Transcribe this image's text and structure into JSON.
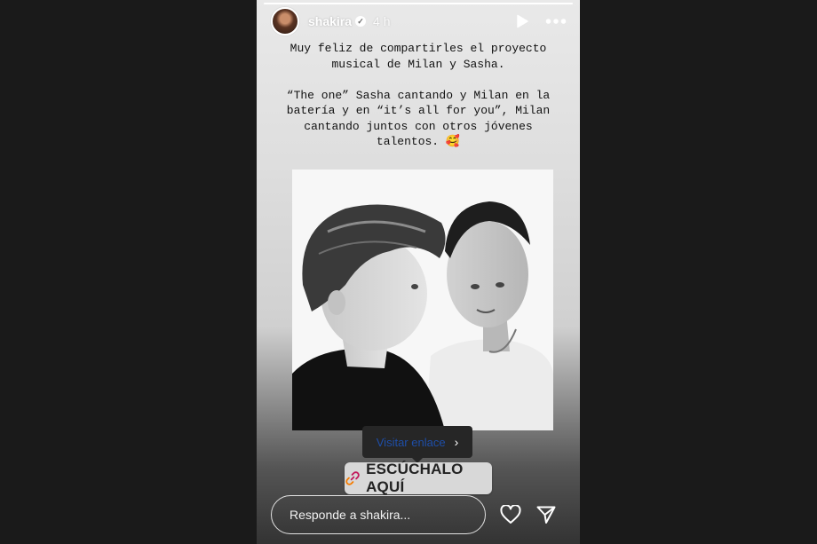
{
  "story": {
    "progress": 1.0,
    "user": {
      "username": "shakira",
      "verified": true,
      "time_ago": "4 h"
    },
    "controls": {
      "play_icon": "play-icon",
      "more_icon": "more-options-icon"
    },
    "caption": "Muy feliz de compartirles el proyecto\nmusical de Milan y Sasha.\n\n“The one” Sasha cantando y Milan en la\nbatería y en “it’s all for you”, Milan\ncantando juntos con otros jóvenes\ntalentos. 🥰",
    "tooltip": {
      "label": "Visitar enlace",
      "chevron": "›"
    },
    "link_sticker": {
      "label": "ESCÚCHALO AQUÍ",
      "icon": "link-icon",
      "icon_color": "#c2185b"
    },
    "footer": {
      "reply_placeholder": "Responde a shakira...",
      "like_icon": "heart-icon",
      "share_icon": "send-icon"
    }
  }
}
